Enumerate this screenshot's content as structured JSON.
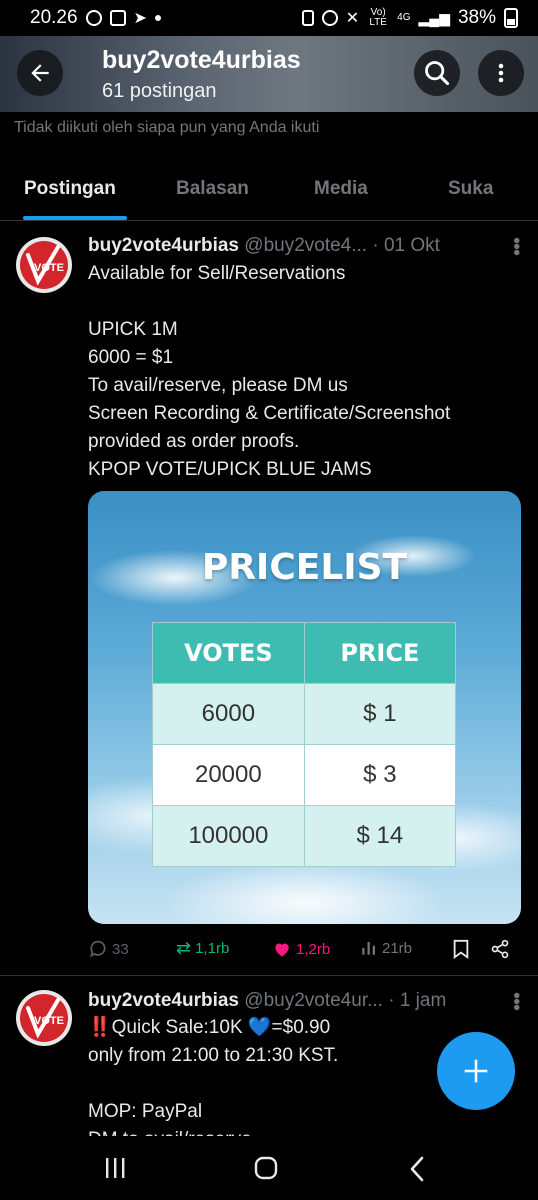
{
  "status_bar": {
    "time": "20.26",
    "net_label_1": "Vo) LTE",
    "net_label_2": "4G",
    "battery": "38%"
  },
  "header": {
    "name": "buy2vote4urbias",
    "post_count": "61 postingan"
  },
  "follow_note": "Tidak diikuti oleh siapa pun yang Anda ikuti",
  "tabs": [
    "Postingan",
    "Balasan",
    "Media",
    "Suka"
  ],
  "posts": [
    {
      "author": "buy2vote4urbias",
      "handle": "@buy2vote4...",
      "time": "· 01 Okt",
      "avatar_text": "VOTE",
      "text": "Available for Sell/Reservations\n\nUPICK 1M\n6000 = $1\nTo avail/reserve, please DM us\nScreen Recording & Certificate/Screenshot provided as order proofs.\nKPOP VOTE/UPICK BLUE JAMS",
      "media": {
        "title": "PRICELIST",
        "headers": [
          "VOTES",
          "PRICE"
        ],
        "rows": [
          [
            "6000",
            "$ 1"
          ],
          [
            "20000",
            "$ 3"
          ],
          [
            "100000",
            "$ 14"
          ]
        ]
      },
      "stats": {
        "replies": "33",
        "reposts": "1,1rb",
        "likes": "1,2rb",
        "views": "21rb"
      }
    },
    {
      "author": "buy2vote4urbias",
      "handle": "@buy2vote4ur...",
      "time": "· 1 jam",
      "avatar_text": "VOTE",
      "text": "‼️Quick Sale:10K 💙=$0.90\nonly from 21:00 to 21:30 KST.\n\nMOP: PayPal\nDM to avail/reserve"
    }
  ],
  "colors": {
    "accent": "#1d9bf0",
    "repost": "#00ba7c",
    "like": "#f91880",
    "muted": "#71767b",
    "vote_red": "#d1262b",
    "table_header": "#3fbcb2"
  }
}
